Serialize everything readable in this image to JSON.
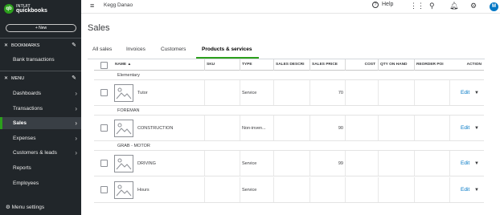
{
  "sidebar": {
    "logo": {
      "line1": "INTUIT",
      "line2": "quickbooks"
    },
    "new_label": "+ New",
    "bookmarks_label": "BOOKMARKS",
    "bank_transactions": "Bank transactions",
    "menu_label": "MENU",
    "items": [
      {
        "label": "Dashboards",
        "active": false
      },
      {
        "label": "Transactions",
        "active": false
      },
      {
        "label": "Sales",
        "active": true
      },
      {
        "label": "Expenses",
        "active": false
      },
      {
        "label": "Customers & leads",
        "active": false
      },
      {
        "label": "Reports",
        "active": false
      },
      {
        "label": "Employees",
        "active": false
      }
    ],
    "menu_settings": "Menu settings"
  },
  "topbar": {
    "company": "Kegg Danao",
    "help": "Help",
    "avatar_initial": "M",
    "icons": [
      "hamburger-icon",
      "question-icon",
      "grid-icon",
      "search-icon",
      "bell-icon",
      "gear-icon"
    ]
  },
  "page": {
    "title": "Sales"
  },
  "tabs": [
    "All sales",
    "Invoices",
    "Customers",
    "Products & services"
  ],
  "active_tab": "Products & services",
  "table": {
    "headers": {
      "name": "NAME ▲",
      "sku": "SKU",
      "type": "TYPE",
      "sales_desc": "SALES DESCRI",
      "sales_price": "SALES PRICE",
      "cost": "COST",
      "qty": "QTY ON HAND",
      "reorder": "REORDER POI",
      "action": "ACTION"
    },
    "groups": [
      {
        "name": "Elementary",
        "rows": [
          {
            "name": "Tutor",
            "type": "Service",
            "price": "70",
            "action": "Edit"
          }
        ]
      },
      {
        "name": "FOREMAN",
        "rows": [
          {
            "name": "CONSTRUCTION",
            "type": "Non-inven...",
            "price": "90",
            "action": "Edit"
          }
        ]
      },
      {
        "name": "GRAB - MOTOR",
        "rows": [
          {
            "name": "DRIVING",
            "type": "Service",
            "price": "99",
            "action": "Edit"
          },
          {
            "name": "Hours",
            "type": "Service",
            "price": "",
            "action": "Edit"
          }
        ]
      }
    ]
  },
  "colors": {
    "brand_green": "#2ca01c",
    "sidebar_bg": "#21262a",
    "link_blue": "#0077c5"
  }
}
